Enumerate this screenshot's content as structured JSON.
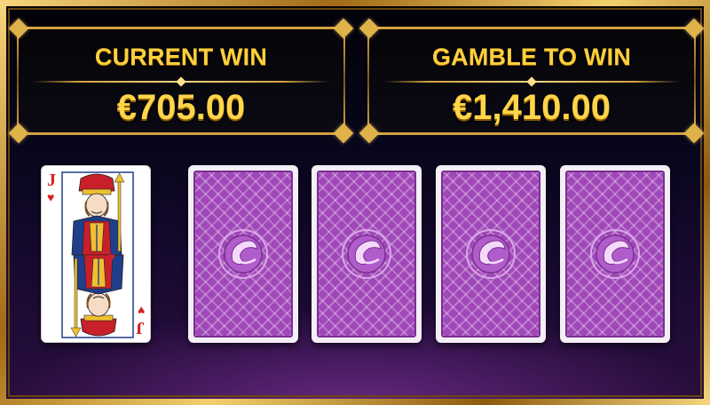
{
  "current_win": {
    "label": "CURRENT WIN",
    "amount": "€705.00"
  },
  "gamble_to_win": {
    "label": "GAMBLE TO WIN",
    "amount": "€1,410.00"
  },
  "dealer_card": {
    "rank": "J",
    "suit_glyph": "♥",
    "suit": "hearts",
    "color": "#d61f26"
  },
  "choice_cards": [
    {
      "state": "face-down"
    },
    {
      "state": "face-down"
    },
    {
      "state": "face-down"
    },
    {
      "state": "face-down"
    }
  ],
  "colors": {
    "gold": "#ffcf3d",
    "frame": "#d3a140",
    "card_back": "#a047b9"
  }
}
